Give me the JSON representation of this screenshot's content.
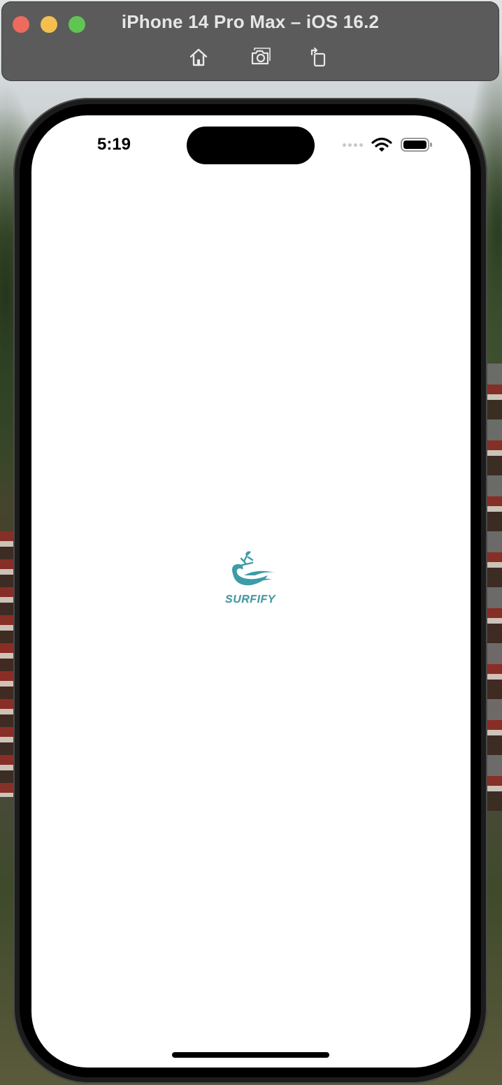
{
  "simulator": {
    "title": "iPhone 14 Pro Max – iOS 16.2",
    "toolbar": [
      "home-icon",
      "screenshot-icon",
      "rotate-icon"
    ],
    "traffic_lights": {
      "close": "#ed6a5e",
      "minimize": "#f5bf4f",
      "zoom": "#61c554"
    }
  },
  "status_bar": {
    "time": "5:19",
    "icons": [
      "signal-dots-icon",
      "wifi-icon",
      "battery-icon"
    ]
  },
  "app": {
    "logo_text": "SURFIFY",
    "accent_color": "#3f9ba6"
  }
}
